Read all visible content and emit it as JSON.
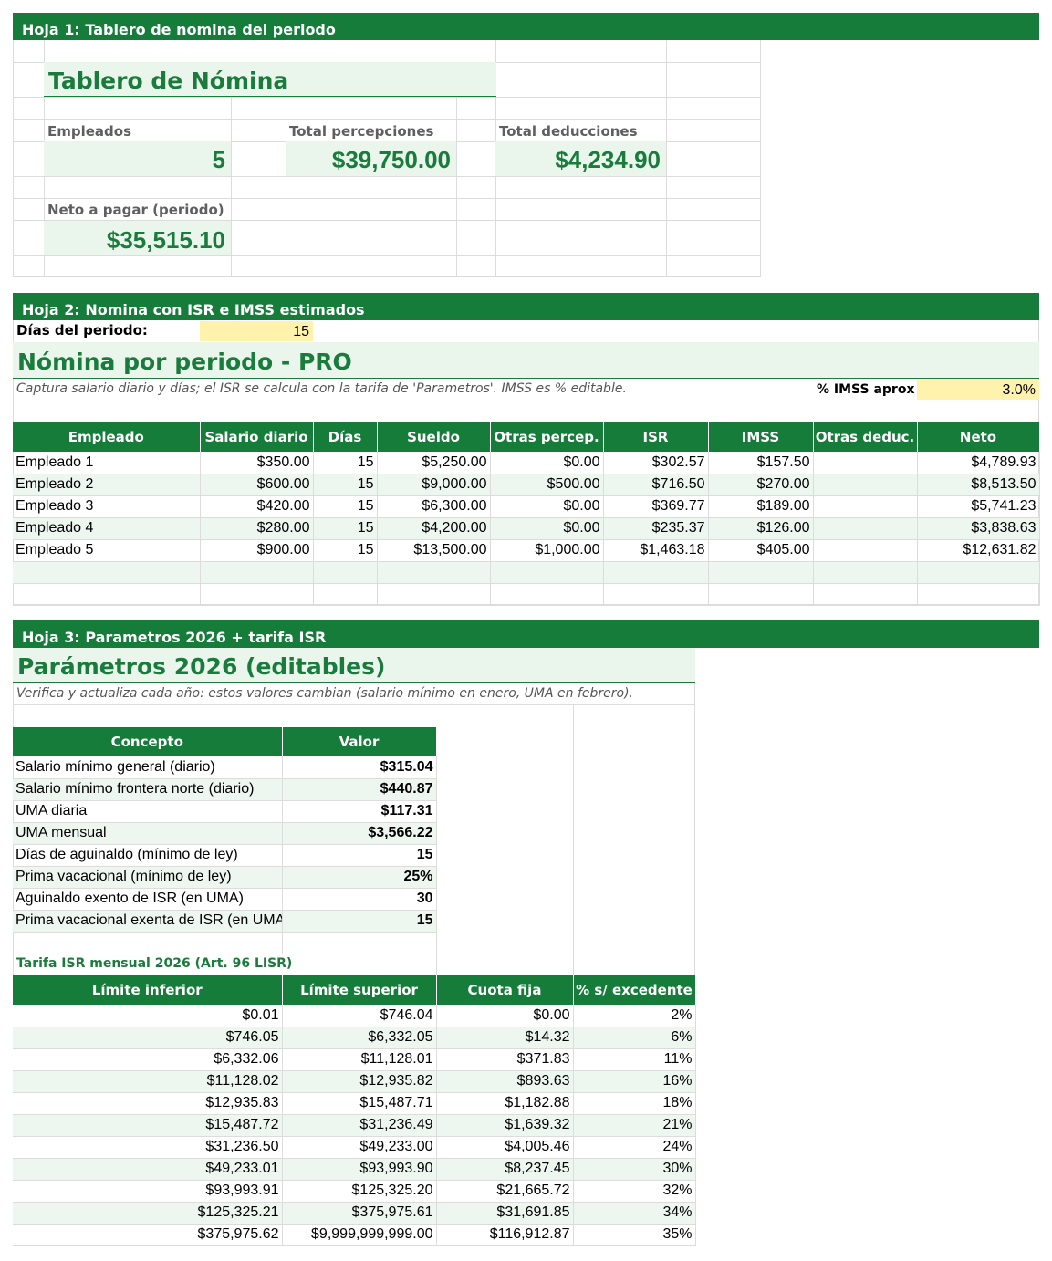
{
  "sheet1": {
    "banner": "Hoja 1: Tablero de nomina del periodo",
    "title": "Tablero de Nómina",
    "employees_label": "Empleados",
    "employees_value": "5",
    "perceptions_label": "Total percepciones",
    "perceptions_value": "$39,750.00",
    "deductions_label": "Total deducciones",
    "deductions_value": "$4,234.90",
    "net_label": "Neto a pagar (periodo)",
    "net_value": "$35,515.10"
  },
  "sheet2": {
    "banner": "Hoja 2: Nomina con ISR e IMSS estimados",
    "days_label": "Días del periodo:",
    "days_value": "15",
    "title": "Nómina por periodo - PRO",
    "note": "Captura salario diario y días; el ISR se calcula con la tarifa de 'Parametros'. IMSS es % editable.",
    "imss_label": "% IMSS aprox (",
    "imss_value": "3.0%",
    "headers": [
      "Empleado",
      "Salario diario",
      "Días",
      "Sueldo",
      "Otras percep.",
      "ISR",
      "IMSS",
      "Otras deduc.",
      "Neto"
    ],
    "rows": [
      [
        "Empleado 1",
        "$350.00",
        "15",
        "$5,250.00",
        "$0.00",
        "$302.57",
        "$157.50",
        "",
        "$4,789.93"
      ],
      [
        "Empleado 2",
        "$600.00",
        "15",
        "$9,000.00",
        "$500.00",
        "$716.50",
        "$270.00",
        "",
        "$8,513.50"
      ],
      [
        "Empleado 3",
        "$420.00",
        "15",
        "$6,300.00",
        "$0.00",
        "$369.77",
        "$189.00",
        "",
        "$5,741.23"
      ],
      [
        "Empleado 4",
        "$280.00",
        "15",
        "$4,200.00",
        "$0.00",
        "$235.37",
        "$126.00",
        "",
        "$3,838.63"
      ],
      [
        "Empleado 5",
        "$900.00",
        "15",
        "$13,500.00",
        "$1,000.00",
        "$1,463.18",
        "$405.00",
        "",
        "$12,631.82"
      ]
    ]
  },
  "sheet3": {
    "banner": "Hoja 3: Parametros 2026 + tarifa ISR",
    "title": "Parámetros 2026 (editables)",
    "note": "Verifica y actualiza cada año: estos valores cambian (salario mínimo en enero, UMA en febrero).",
    "param_headers": [
      "Concepto",
      "Valor"
    ],
    "params": [
      [
        "Salario mínimo general (diario)",
        "$315.04"
      ],
      [
        "Salario mínimo frontera norte (diario)",
        "$440.87"
      ],
      [
        "UMA diaria",
        "$117.31"
      ],
      [
        "UMA mensual",
        "$3,566.22"
      ],
      [
        "Días de aguinaldo (mínimo de ley)",
        "15"
      ],
      [
        "Prima vacacional (mínimo de ley)",
        "25%"
      ],
      [
        "Aguinaldo exento de ISR (en UMA)",
        "30"
      ],
      [
        "Prima vacacional exenta de ISR (en UMA)",
        "15"
      ]
    ],
    "tarifa_title": "Tarifa ISR mensual 2026 (Art. 96 LISR)",
    "tarifa_headers": [
      "Límite inferior",
      "Límite superior",
      "Cuota fija",
      "% s/ excedente"
    ],
    "tarifa": [
      [
        "$0.01",
        "$746.04",
        "$0.00",
        "2%"
      ],
      [
        "$746.05",
        "$6,332.05",
        "$14.32",
        "6%"
      ],
      [
        "$6,332.06",
        "$11,128.01",
        "$371.83",
        "11%"
      ],
      [
        "$11,128.02",
        "$12,935.82",
        "$893.63",
        "16%"
      ],
      [
        "$12,935.83",
        "$15,487.71",
        "$1,182.88",
        "18%"
      ],
      [
        "$15,487.72",
        "$31,236.49",
        "$1,639.32",
        "21%"
      ],
      [
        "$31,236.50",
        "$49,233.00",
        "$4,005.46",
        "24%"
      ],
      [
        "$49,233.01",
        "$93,993.90",
        "$8,237.45",
        "30%"
      ],
      [
        "$93,993.91",
        "$125,325.20",
        "$21,665.72",
        "32%"
      ],
      [
        "$125,325.21",
        "$375,975.61",
        "$31,691.85",
        "34%"
      ],
      [
        "$375,975.62",
        "$9,999,999,999.00",
        "$116,912.87",
        "35%"
      ]
    ]
  },
  "colors": {
    "header_green": "#157c3a",
    "title_green": "#1a7c3c",
    "band": "#eaf5ec",
    "input_yellow": "#fff2ac"
  }
}
